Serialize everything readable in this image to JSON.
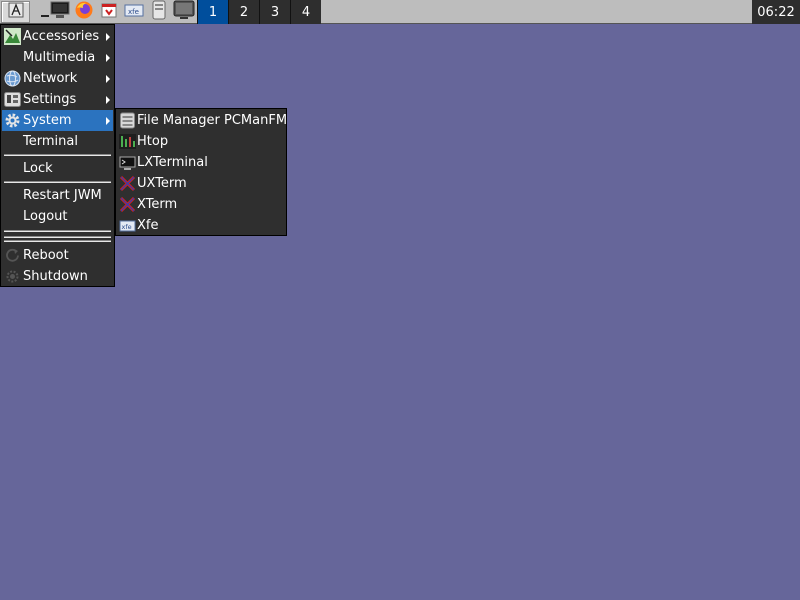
{
  "taskbar": {
    "launchers": [
      {
        "icon": "root-menu-icon"
      },
      {
        "icon": "show-desktop-icon"
      },
      {
        "icon": "terminal-icon"
      },
      {
        "icon": "firefox-icon"
      },
      {
        "icon": "installer-icon"
      },
      {
        "icon": "network-icon"
      },
      {
        "icon": "storage-icon"
      },
      {
        "icon": "monitor-icon"
      }
    ],
    "workspaces": [
      "1",
      "2",
      "3",
      "4"
    ],
    "active_workspace": "1",
    "clock": "06:22"
  },
  "main_menu": {
    "items": [
      {
        "label": "Accessories",
        "icon": "accessories-icon",
        "submenu": true
      },
      {
        "label": "Multimedia",
        "icon": "",
        "submenu": true
      },
      {
        "label": "Network",
        "icon": "network-globe-icon",
        "submenu": true
      },
      {
        "label": "Settings",
        "icon": "settings-icon",
        "submenu": true
      },
      {
        "label": "System",
        "icon": "system-gear-icon",
        "submenu": true,
        "active": true
      },
      {
        "label": "Terminal",
        "icon": "",
        "submenu": false
      },
      {
        "label": "Lock",
        "icon": "",
        "submenu": false
      },
      {
        "label": "Restart JWM",
        "icon": "",
        "submenu": false
      },
      {
        "label": "Logout",
        "icon": "",
        "submenu": false
      },
      {
        "label": "Reboot",
        "icon": "reboot-icon",
        "submenu": false
      },
      {
        "label": "Shutdown",
        "icon": "shutdown-icon",
        "submenu": false
      }
    ]
  },
  "system_menu": {
    "items": [
      {
        "label": "File Manager PCManFM",
        "icon": "file-manager-icon"
      },
      {
        "label": "Htop",
        "icon": "htop-icon"
      },
      {
        "label": "LXTerminal",
        "icon": "lxterminal-icon"
      },
      {
        "label": "UXTerm",
        "icon": "uxterm-icon"
      },
      {
        "label": "XTerm",
        "icon": "xterm-icon"
      },
      {
        "label": "Xfe",
        "icon": "xfe-icon"
      }
    ]
  },
  "colors": {
    "desktop": "#66669a",
    "menu_bg": "#2f2f2f",
    "highlight": "#2b73bf",
    "active_workspace": "#004e9c",
    "panel": "#bdbdbd"
  }
}
